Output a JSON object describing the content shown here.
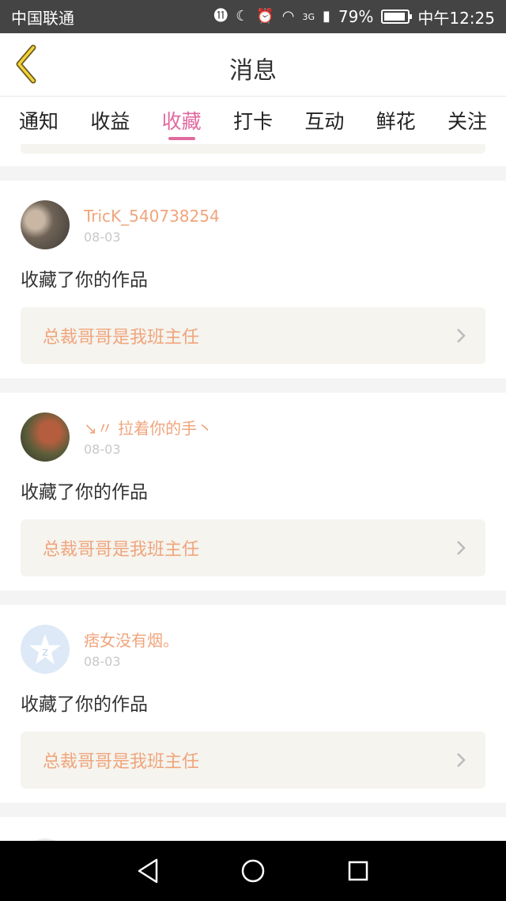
{
  "status_bar": {
    "carrier": "中国联通",
    "network": "3G",
    "battery": "79%",
    "time": "中午12:25"
  },
  "header": {
    "title": "消息"
  },
  "tabs": [
    {
      "label": "通知"
    },
    {
      "label": "收益"
    },
    {
      "label": "收藏"
    },
    {
      "label": "打卡"
    },
    {
      "label": "互动"
    },
    {
      "label": "鲜花"
    },
    {
      "label": "关注"
    }
  ],
  "active_tab": "收藏",
  "messages": [
    {
      "username": "TricK_540738254",
      "date": "08-03",
      "action": "收藏了你的作品",
      "work_title": "总裁哥哥是我班主任"
    },
    {
      "username": "↘〃 拉着你的手丶",
      "date": "08-03",
      "action": "收藏了你的作品",
      "work_title": "总裁哥哥是我班主任"
    },
    {
      "username": "痞女没有烟。",
      "date": "08-03",
      "action": "收藏了你的作品",
      "work_title": "总裁哥哥是我班主任"
    }
  ],
  "colors": {
    "accent": "#e06aa0",
    "username": "#f0a57c",
    "status_bar": "#444444"
  }
}
